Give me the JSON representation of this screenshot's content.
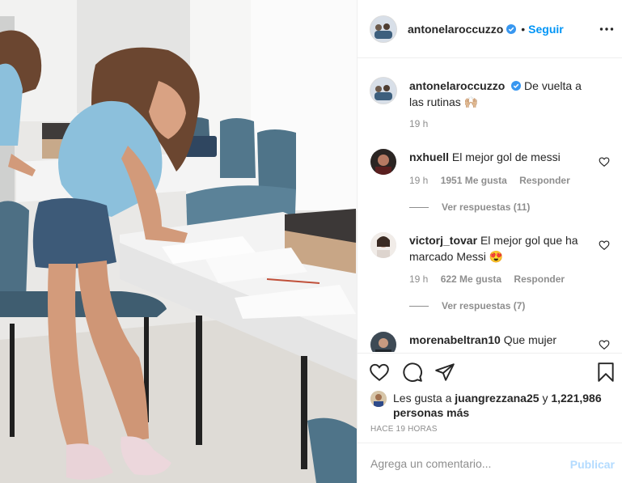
{
  "post": {
    "author": {
      "username": "antonelaroccuzzo",
      "verified": true,
      "separator": "•",
      "follow_label": "Seguir"
    },
    "options_icon": "more-horizontal-icon",
    "photo_description_icon": "post-photo",
    "caption": {
      "username": "antonelaroccuzzo",
      "text": "De vuelta a las rutinas 🙌🏼",
      "time": "19 h"
    },
    "comments": [
      {
        "username": "nxhuell",
        "text": "El mejor gol de messi",
        "time": "19 h",
        "likes": "1951 Me gusta",
        "reply_label": "Responder",
        "view_replies": "Ver respuestas (11)"
      },
      {
        "username": "victorj_tovar",
        "text": "El mejor gol que ha marcado Messi 😍",
        "time": "19 h",
        "likes": "622 Me gusta",
        "reply_label": "Responder",
        "view_replies": "Ver respuestas (7)"
      },
      {
        "username": "morenabeltran10",
        "text": "Que mujer"
      }
    ],
    "actions": {
      "like_icon": "heart-icon",
      "comment_icon": "comment-icon",
      "share_icon": "paper-plane-icon",
      "save_icon": "bookmark-icon"
    },
    "likes": {
      "prefix": "Les gusta a",
      "user": "juangrezzana25",
      "conjunction": "y",
      "count_text": "1,221,986 personas más"
    },
    "time_ago": "HACE 19 HORAS",
    "add_comment": {
      "placeholder": "Agrega un comentario...",
      "publish_label": "Publicar"
    },
    "colors": {
      "accent": "#0095f6",
      "publish_disabled": "#b3dbff",
      "muted": "#8e8e8e",
      "text": "#262626"
    }
  }
}
